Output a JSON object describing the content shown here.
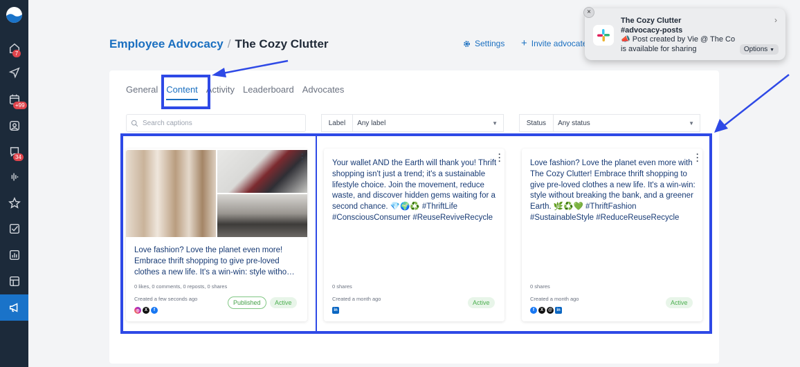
{
  "sidebar": {
    "badges": {
      "home": "7",
      "calendar": "+99",
      "messages": "34"
    }
  },
  "header": {
    "crumb": "Employee Advocacy",
    "current": "The Cozy Clutter",
    "settings_label": "Settings",
    "invite_label": "Invite advocate"
  },
  "tabs": [
    "General",
    "Content",
    "Activity",
    "Leaderboard",
    "Advocates"
  ],
  "filters": {
    "search_placeholder": "Search captions",
    "label_title": "Label",
    "label_value": "Any label",
    "status_title": "Status",
    "status_value": "Any status"
  },
  "cards": [
    {
      "caption": "Love fashion? Love the planet even more! Embrace thrift shopping to give pre-loved clothes a new life. It's a win-win: style witho…",
      "stats": "0 likes, 0 comments, 0 reposts, 0 shares",
      "created": "Created a few seconds ago",
      "published": "Published",
      "status": "Active"
    },
    {
      "caption": "Your wallet AND the Earth will thank you! Thrift shopping isn't just a trend; it's a sustainable lifestyle choice. Join the movement, reduce waste, and discover hidden gems waiting for a second chance. 💎🌍♻️ #ThriftLife #ConsciousConsumer #ReuseReviveRecycle",
      "stats": "0 shares",
      "created": "Created a month ago",
      "status": "Active"
    },
    {
      "caption": "Love fashion? Love the planet even more with The Cozy Clutter! Embrace thrift shopping to give pre-loved clothes a new life. It's a win-win: style without breaking the bank, and a greener Earth. 🌿♻️💚 #ThriftFashion #SustainableStyle #ReduceReuseRecycle",
      "stats": "0 shares",
      "created": "Created a month ago",
      "status": "Active"
    }
  ],
  "notification": {
    "title": "The Cozy Clutter",
    "channel": "#advocacy-posts",
    "line1": "📣 Post created by Vie @ The Co",
    "line2": "is available for sharing",
    "options": "Options"
  },
  "colors": {
    "accent": "#1a6fc0",
    "sidebar": "#1c2a3a",
    "highlight": "#2e49e6",
    "active_green": "#4caf50"
  }
}
